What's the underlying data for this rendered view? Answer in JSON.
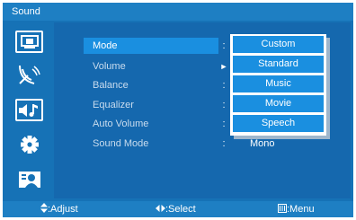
{
  "title": "Sound",
  "sidebar": {
    "items": [
      {
        "icon": "picture-icon",
        "active": false
      },
      {
        "icon": "satellite-dish-icon",
        "active": false
      },
      {
        "icon": "sound-icon",
        "active": true
      },
      {
        "icon": "gear-icon",
        "active": false
      },
      {
        "icon": "user-icon",
        "active": false
      }
    ]
  },
  "menu": {
    "rows": [
      {
        "label": "Mode",
        "sep": ":",
        "value": ""
      },
      {
        "label": "Volume",
        "sep": "►",
        "value": ""
      },
      {
        "label": "Balance",
        "sep": ":",
        "value": ""
      },
      {
        "label": "Equalizer",
        "sep": ":",
        "value": ""
      },
      {
        "label": "Auto Volume",
        "sep": ":",
        "value": ""
      },
      {
        "label": "Sound Mode",
        "sep": ":",
        "value": "Mono"
      }
    ]
  },
  "dropdown": {
    "options": [
      "Custom",
      "Standard",
      "Music",
      "Movie",
      "Speech"
    ]
  },
  "footer": {
    "adjust": ":Adjust",
    "select": ":Select",
    "menu": ":Menu"
  },
  "colors": {
    "frame": "#1672b6",
    "highlight": "#1a8fe0",
    "text_dim": "#c9dcee"
  }
}
